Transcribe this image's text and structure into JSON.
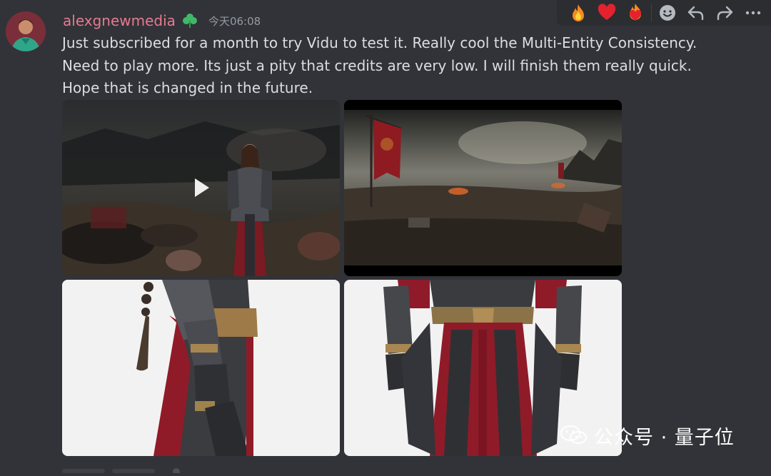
{
  "message": {
    "username": "alexgnewmedia",
    "timestamp": "今天06:08",
    "text": "Just subscribed for a month to try Vidu to test it. Really cool the Multi-Entity Consistency. Need to play more. Its just a pity that credits are very low. I will finish them really quick. Hope that is changed in the future."
  },
  "toolbar": {
    "buttons": [
      "fire-emoji",
      "heart-emoji",
      "fire-heart-emoji",
      "add-reaction",
      "reply",
      "forward",
      "more"
    ]
  },
  "attachments": {
    "items": [
      {
        "kind": "video",
        "description": "warrior-battlefield"
      },
      {
        "kind": "image",
        "description": "battlefield-banner"
      },
      {
        "kind": "image",
        "description": "armor-side"
      },
      {
        "kind": "image",
        "description": "armor-front"
      }
    ]
  },
  "watermark": {
    "text": "公众号 · 量子位"
  },
  "colors": {
    "background": "#313338",
    "username": "#e67a90",
    "text": "#dbdee1",
    "muted": "#949ba4"
  }
}
